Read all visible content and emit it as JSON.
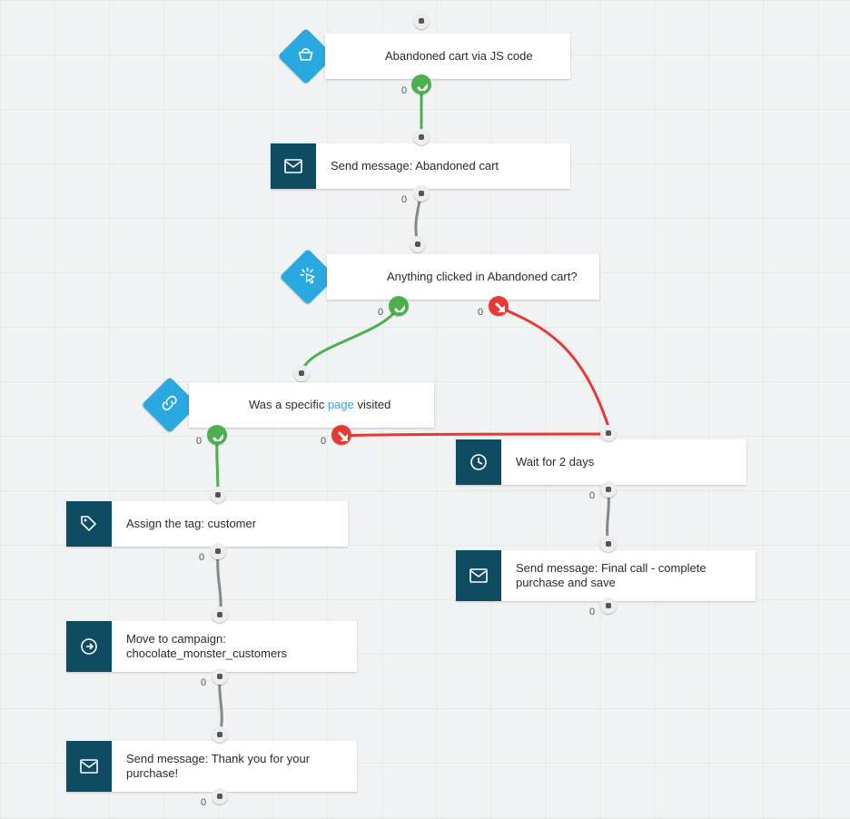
{
  "nodes": {
    "n1": {
      "label": "Abandoned cart via JS code",
      "icon": "basket-icon",
      "type": "condition"
    },
    "n2": {
      "label": "Send message: Abandoned cart",
      "icon": "envelope-icon",
      "type": "action"
    },
    "n3": {
      "label_prefix": "Anything clicked in Abandoned cart?",
      "icon": "click-icon",
      "type": "condition"
    },
    "n4": {
      "label_prefix": "Was a specific ",
      "label_link": "page",
      "label_suffix": " visited",
      "icon": "link-icon",
      "type": "condition"
    },
    "n5": {
      "label": "Assign the tag: customer",
      "icon": "tag-icon",
      "type": "action"
    },
    "n6": {
      "label": "Move to campaign: chocolate_monster_customers",
      "icon": "arrow-circle-icon",
      "type": "action"
    },
    "n7": {
      "label": "Send message: Thank you for your purchase!",
      "icon": "envelope-icon",
      "type": "action"
    },
    "n8": {
      "label": "Wait for 2 days",
      "icon": "clock-icon",
      "type": "action"
    },
    "n9": {
      "label": "Send message: Final call - complete purchase and save",
      "icon": "envelope-icon",
      "type": "action"
    }
  },
  "port_zero": "0",
  "edges": [
    {
      "from": "n1",
      "to": "n2",
      "kind": "yes"
    },
    {
      "from": "n2",
      "to": "n3",
      "kind": "neutral"
    },
    {
      "from": "n3",
      "to": "n4",
      "kind": "yes"
    },
    {
      "from": "n3",
      "to": "n8",
      "kind": "no"
    },
    {
      "from": "n4",
      "to": "n5",
      "kind": "yes"
    },
    {
      "from": "n4",
      "to": "n8",
      "kind": "no"
    },
    {
      "from": "n5",
      "to": "n6",
      "kind": "neutral"
    },
    {
      "from": "n6",
      "to": "n7",
      "kind": "neutral"
    },
    {
      "from": "n8",
      "to": "n9",
      "kind": "neutral"
    }
  ],
  "colors": {
    "teal": "#0f4c61",
    "blue": "#2aa9e0",
    "green": "#4caf50",
    "red": "#e53935",
    "neutral": "#888888"
  }
}
